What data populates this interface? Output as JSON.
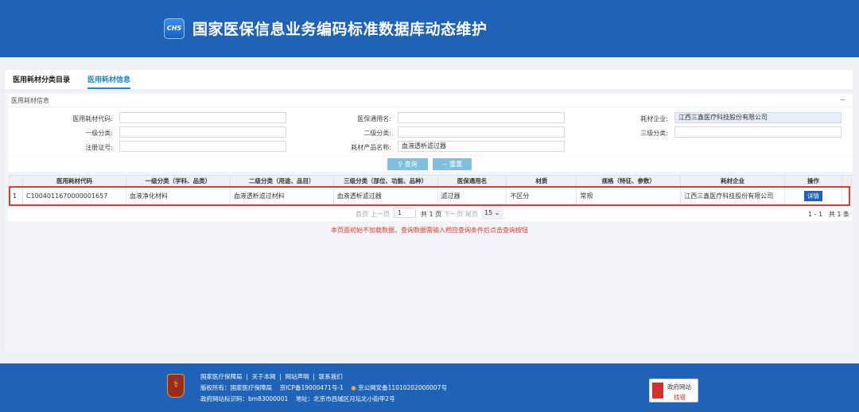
{
  "header": {
    "logo_text": "CHS",
    "title": "国家医保信息业务编码标准数据库动态维护"
  },
  "tabs": [
    {
      "label": "医用耗材分类目录",
      "active": false
    },
    {
      "label": "医用耗材信息",
      "active": true
    }
  ],
  "panel": {
    "title": "医用耗材信息",
    "collapse_icon": "minus-icon"
  },
  "form": {
    "code_label": "医用耗材代码:",
    "code_value": "",
    "generic_label": "医保通用名:",
    "generic_value": "",
    "company_label": "耗材企业:",
    "company_value": "江西三鑫医疗科技股份有限公司",
    "level1_label": "一级分类:",
    "level1_value": "",
    "level2_label": "二级分类:",
    "level2_value": "",
    "level3_label": "三级分类:",
    "level3_value": "",
    "reg_label": "注册证号:",
    "reg_value": "",
    "product_label": "耗材产品名称:",
    "product_value": "血液透析滤过器"
  },
  "buttons": {
    "query": "查询",
    "reset": "重置"
  },
  "table": {
    "headers": [
      "",
      "医用耗材代码",
      "一级分类（学科、品类）",
      "二级分类（用途、品目）",
      "三级分类（部位、功能、品种）",
      "医保通用名",
      "材质",
      "规格（特征、参数）",
      "耗材企业",
      "操作"
    ],
    "rows": [
      [
        "1",
        "C1004011670000001657",
        "血液净化材料",
        "血液透析滤过材料",
        "血液透析滤过器",
        "滤过器",
        "不区分",
        "常规",
        "江西三鑫医疗科技股份有限公司",
        "详情"
      ]
    ]
  },
  "pager": {
    "first": "首页",
    "prev": "上一页",
    "page": "1",
    "total_pages": "共 1 页",
    "next": "下一页",
    "last": "尾页",
    "page_size": "15",
    "summary": "1 - 1   共 1 条"
  },
  "message": "本页面初始不加载数据，查询数据需输入相应查询条件后点击查询按钮",
  "footer": {
    "links": [
      "国家医疗保障局",
      "关于本网",
      "网站声明",
      "联系我们"
    ],
    "copyright": "版权所有：国家医疗保障局",
    "icp": "京ICP备19000471号-1",
    "police": "京公网安备11010202000007号",
    "site_id": "政府网站标识码：bm83000001",
    "address": "地址：北京市西城区月坛北小街甲2号",
    "find_error_line1": "政府网站",
    "find_error_line2": "找错"
  },
  "colors": {
    "brand": "#1e63b8",
    "accent": "#1e8bc3",
    "highlight": "#e53935"
  }
}
